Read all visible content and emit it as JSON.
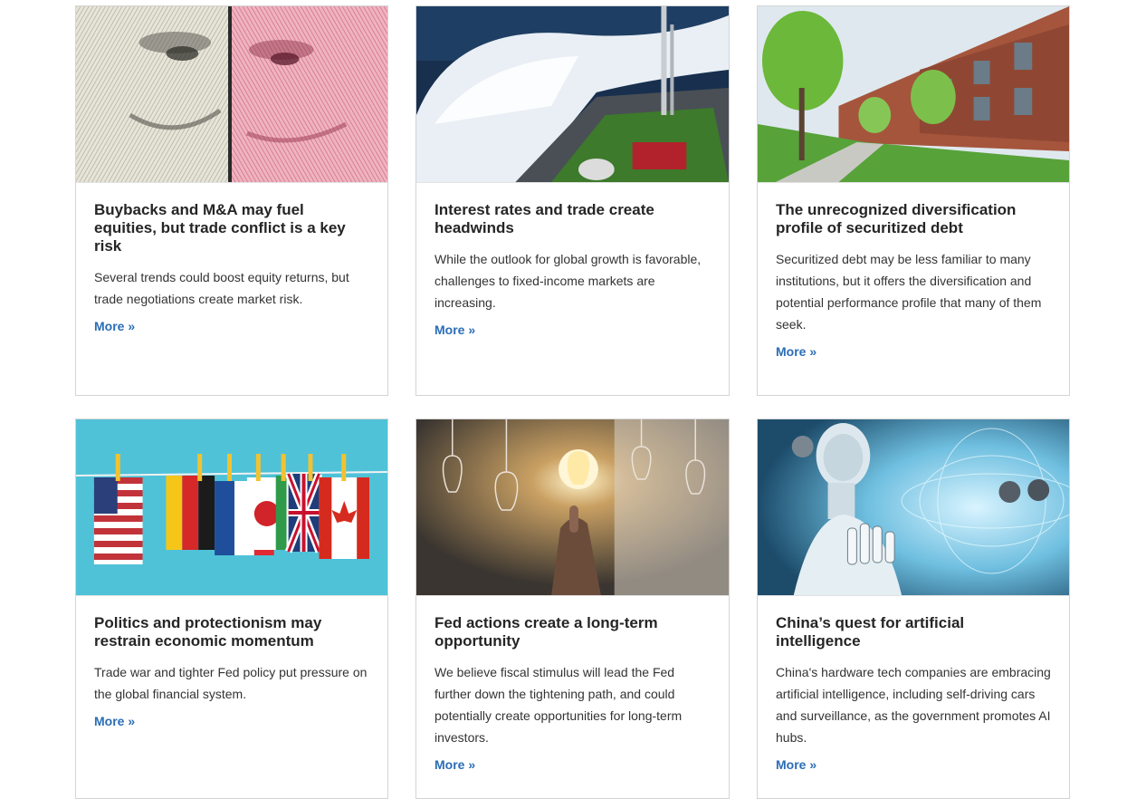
{
  "cards": [
    {
      "title": "Buybacks and M&A may fuel equities, but trade conflict is a key risk",
      "text": "Several trends could boost equity returns, but trade negotiations create market risk.",
      "more": "More »",
      "image": "currency-portraits-image"
    },
    {
      "title": "Interest rates and trade create headwinds",
      "text": "While the outlook for global growth is favorable, challenges to fixed-income markets are increasing.",
      "more": "More »",
      "image": "ship-wave-image"
    },
    {
      "title": "The unrecognized diversification profile of securitized debt",
      "text": "Securitized debt may be less familiar to many institutions, but it offers the diversification and potential performance profile that many of them seek.",
      "more": "More »",
      "image": "townhouses-image"
    },
    {
      "title": "Politics and protectionism may restrain economic momentum",
      "text": "Trade war and tighter Fed policy put pressure on the global financial system.",
      "more": "More »",
      "image": "flags-clothesline-image"
    },
    {
      "title": "Fed actions create a long-term opportunity",
      "text": "We believe fiscal stimulus will lead the Fed further down the tightening path, and could potentially create opportunities for long-term investors.",
      "more": "More »",
      "image": "lightbulbs-image"
    },
    {
      "title": "China’s quest for artificial intelligence",
      "text": "China's hardware tech companies are embracing artificial intelligence, including self-driving cars and surveillance, as the government promotes AI hubs.",
      "more": "More »",
      "image": "robot-ai-image"
    }
  ],
  "colors": {
    "link": "#2a6db5",
    "title": "#252525",
    "border": "#d4d4d4"
  }
}
